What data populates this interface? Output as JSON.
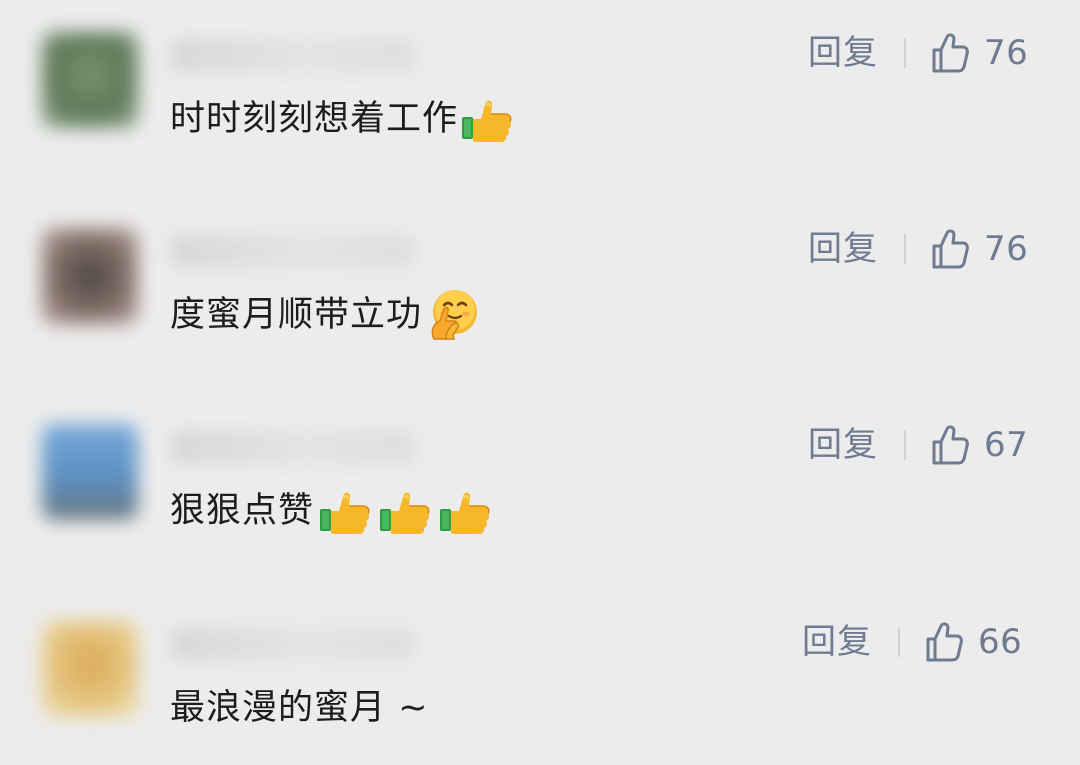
{
  "comments": [
    {
      "text": "时时刻刻想着工作",
      "reply_label": "回复",
      "likes": "76",
      "avatar_color": "#5a7a52",
      "emoji": [
        "thumbs-up-emoji"
      ]
    },
    {
      "text": "度蜜月顺带立功",
      "reply_label": "回复",
      "likes": "76",
      "avatar_color": "#5a4a40",
      "emoji": [
        "shushing-face-emoji"
      ]
    },
    {
      "text": "狠狠点赞",
      "reply_label": "回复",
      "likes": "67",
      "avatar_color": "#5a8ec0",
      "emoji": [
        "thumbs-up-emoji",
        "thumbs-up-emoji",
        "thumbs-up-emoji"
      ]
    },
    {
      "text": "最浪漫的蜜月 ~",
      "reply_label": "回复",
      "likes": "66",
      "avatar_color": "#e2c073",
      "emoji": []
    }
  ],
  "colors": {
    "background": "#ececec",
    "action_text": "#6f7b90",
    "comment_text": "#1d1d1d",
    "divider": "#cdd1d8"
  }
}
